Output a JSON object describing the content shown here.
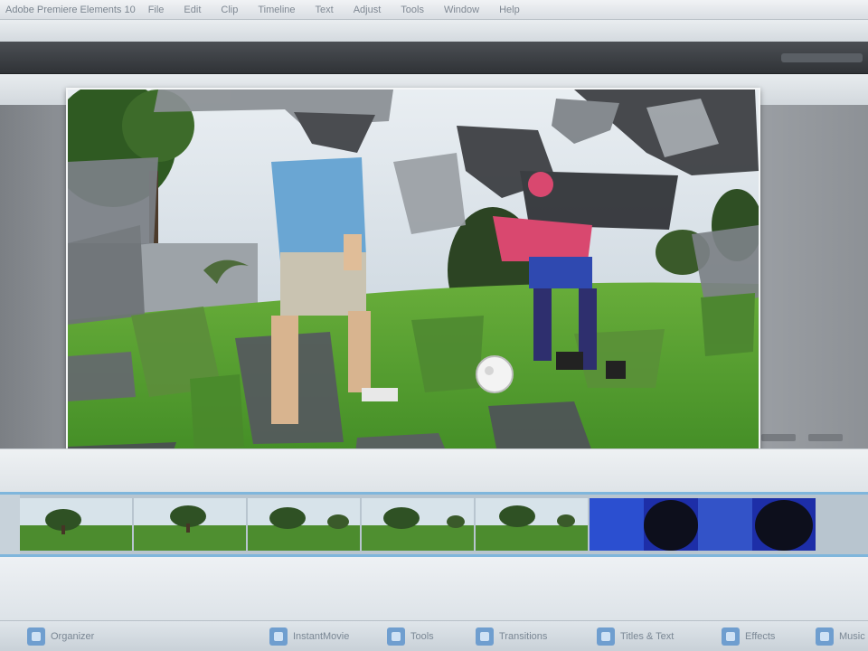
{
  "menubar": {
    "app_title": "Adobe Premiere Elements 10",
    "items": [
      "File",
      "Edit",
      "Clip",
      "Timeline",
      "Text",
      "Adjust",
      "Tools",
      "Window",
      "Help"
    ]
  },
  "timeline": {
    "clips": [
      {
        "kind": "outdoor-park"
      },
      {
        "kind": "outdoor-park"
      },
      {
        "kind": "outdoor-park"
      },
      {
        "kind": "outdoor-park"
      },
      {
        "kind": "outdoor-park"
      },
      {
        "kind": "blue-dark"
      }
    ]
  },
  "toolbar": {
    "items": [
      {
        "label": "Organizer",
        "icon": "organizer-icon"
      },
      {
        "label": "InstantMovie",
        "icon": "instant-movie-icon"
      },
      {
        "label": "Tools",
        "icon": "tools-icon"
      },
      {
        "label": "Transitions",
        "icon": "transitions-icon"
      },
      {
        "label": "Titles & Text",
        "icon": "titles-icon"
      },
      {
        "label": "Effects",
        "icon": "effects-icon"
      },
      {
        "label": "Music",
        "icon": "music-icon"
      }
    ]
  },
  "colors": {
    "accent_blue": "#7fb6dc",
    "dark_bar": "#303337",
    "grass": "#4f9a2e",
    "sky": "#dfe6ec"
  }
}
